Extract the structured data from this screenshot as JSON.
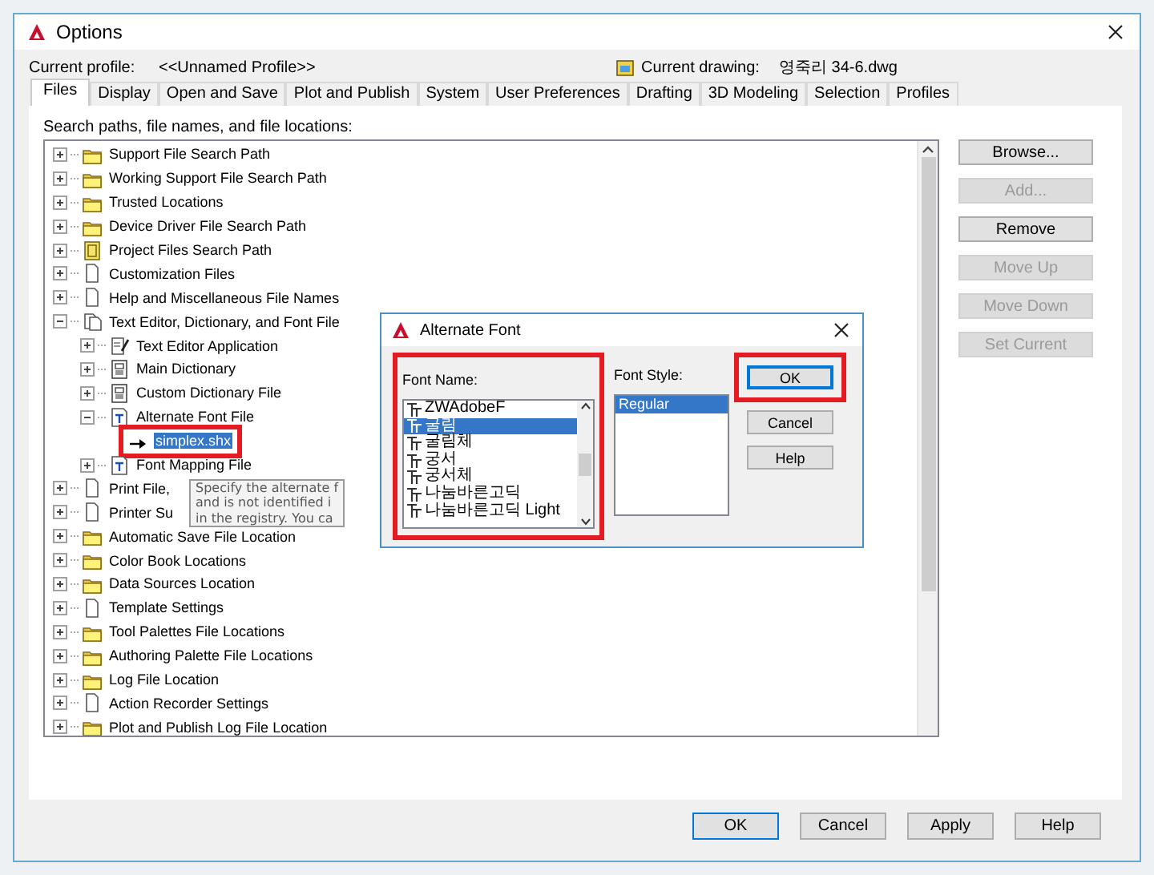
{
  "window": {
    "title": "Options"
  },
  "profile": {
    "label": "Current profile:",
    "value": "<<Unnamed Profile>>",
    "drawing_label": "Current drawing:",
    "drawing_value": "영죽리 34-6.dwg"
  },
  "tabs": [
    {
      "label": "Files",
      "selected": true
    },
    {
      "label": "Display",
      "selected": false
    },
    {
      "label": "Open and Save",
      "selected": false
    },
    {
      "label": "Plot and Publish",
      "selected": false
    },
    {
      "label": "System",
      "selected": false
    },
    {
      "label": "User Preferences",
      "selected": false
    },
    {
      "label": "Drafting",
      "selected": false
    },
    {
      "label": "3D Modeling",
      "selected": false
    },
    {
      "label": "Selection",
      "selected": false
    },
    {
      "label": "Profiles",
      "selected": false
    }
  ],
  "tree_label": "Search paths, file names, and file locations:",
  "tree": [
    {
      "label": "Support File Search Path",
      "kind": "folder",
      "expanded": false,
      "selected": false
    },
    {
      "label": "Working Support File Search Path",
      "kind": "folder",
      "expanded": false,
      "selected": false
    },
    {
      "label": "Trusted Locations",
      "kind": "folder",
      "expanded": false,
      "selected": false
    },
    {
      "label": "Device Driver File Search Path",
      "kind": "folder",
      "expanded": false,
      "selected": false
    },
    {
      "label": "Project Files Search Path",
      "kind": "project",
      "expanded": false,
      "selected": false
    },
    {
      "label": "Customization Files",
      "kind": "file",
      "expanded": false,
      "selected": false
    },
    {
      "label": "Help and Miscellaneous File Names",
      "kind": "file",
      "expanded": false,
      "selected": false
    },
    {
      "label": "Text Editor, Dictionary, and Font File",
      "kind": "files",
      "expanded": true,
      "selected": false,
      "children": [
        {
          "label": "Text Editor Application",
          "kind": "editor",
          "expanded": false,
          "selected": false
        },
        {
          "label": "Main Dictionary",
          "kind": "dictionary",
          "expanded": false,
          "selected": false
        },
        {
          "label": "Custom Dictionary File",
          "kind": "dictionary",
          "expanded": false,
          "selected": false
        },
        {
          "label": "Alternate Font File",
          "kind": "font",
          "expanded": true,
          "selected": false,
          "children": [
            {
              "label": "simplex.shx",
              "kind": "entry",
              "selected": true,
              "highlighted": true
            }
          ]
        },
        {
          "label": "Font Mapping File",
          "kind": "font",
          "expanded": false,
          "selected": false
        }
      ]
    },
    {
      "label": "Print File,",
      "kind": "file",
      "expanded": false,
      "selected": false
    },
    {
      "label": "Printer Su",
      "kind": "file",
      "expanded": false,
      "selected": false
    },
    {
      "label": "Automatic Save File Location",
      "kind": "folder",
      "expanded": false,
      "selected": false
    },
    {
      "label": "Color Book Locations",
      "kind": "folder",
      "expanded": false,
      "selected": false
    },
    {
      "label": "Data Sources Location",
      "kind": "folder",
      "expanded": false,
      "selected": false
    },
    {
      "label": "Template Settings",
      "kind": "file",
      "expanded": false,
      "selected": false
    },
    {
      "label": "Tool Palettes File Locations",
      "kind": "folder",
      "expanded": false,
      "selected": false
    },
    {
      "label": "Authoring Palette File Locations",
      "kind": "folder",
      "expanded": false,
      "selected": false
    },
    {
      "label": "Log File Location",
      "kind": "folder",
      "expanded": false,
      "selected": false
    },
    {
      "label": "Action Recorder Settings",
      "kind": "file",
      "expanded": false,
      "selected": false
    },
    {
      "label": "Plot and Publish Log File Location",
      "kind": "folder",
      "expanded": false,
      "selected": false
    }
  ],
  "side_buttons": [
    {
      "label": "Browse...",
      "disabled": false
    },
    {
      "label": "Add...",
      "disabled": true
    },
    {
      "label": "Remove",
      "disabled": false
    },
    {
      "label": "Move Up",
      "disabled": true
    },
    {
      "label": "Move Down",
      "disabled": true
    },
    {
      "label": "Set Current",
      "disabled": true
    }
  ],
  "tooltip": {
    "lines": [
      "Specify the alternate f",
      "and is not identified i",
      "in the registry. You ca"
    ]
  },
  "dialog": {
    "title": "Alternate Font",
    "font_name": {
      "label": "Font Name:",
      "highlighted": true,
      "items": [
        {
          "label": "ZWAdobeF",
          "selected": false
        },
        {
          "label": "굴림",
          "selected": true
        },
        {
          "label": "굴림체",
          "selected": false
        },
        {
          "label": "궁서",
          "selected": false
        },
        {
          "label": "궁서체",
          "selected": false
        },
        {
          "label": "나눔바른고딕",
          "selected": false
        },
        {
          "label": "나눔바른고딕 Light",
          "selected": false
        }
      ]
    },
    "font_style": {
      "label": "Font Style:",
      "items": [
        {
          "label": "Regular",
          "selected": true
        }
      ]
    },
    "buttons": [
      {
        "label": "OK",
        "highlighted": true
      },
      {
        "label": "Cancel",
        "highlighted": false
      },
      {
        "label": "Help",
        "highlighted": false
      }
    ]
  },
  "buttons": [
    "OK",
    "Cancel",
    "Apply",
    "Help"
  ]
}
